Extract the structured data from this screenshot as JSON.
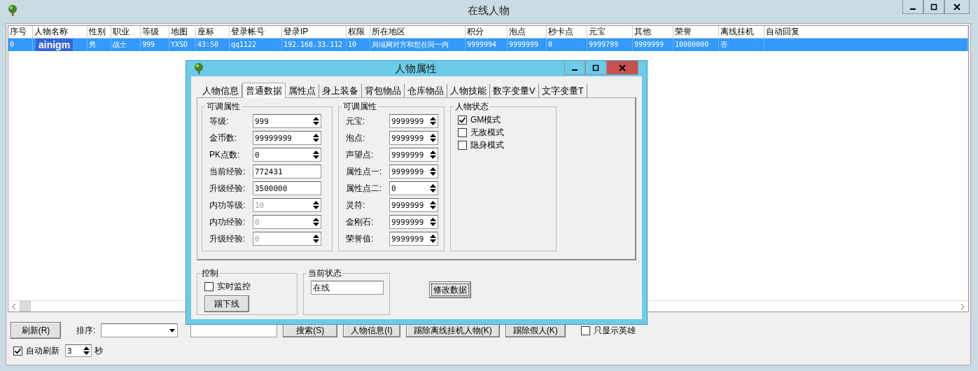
{
  "window": {
    "title": "在线人物"
  },
  "table": {
    "columns": [
      {
        "label": "序号",
        "kind": "plain"
      },
      {
        "label": "人物名称",
        "kind": "name"
      },
      {
        "label": "性别",
        "kind": "plain"
      },
      {
        "label": "职业",
        "kind": "plain"
      },
      {
        "label": "等级",
        "kind": "plain"
      },
      {
        "label": "地图",
        "kind": "plain"
      },
      {
        "label": "座标",
        "kind": "plain"
      },
      {
        "label": "登录帐号",
        "kind": "plain"
      },
      {
        "label": "登录IP",
        "kind": "plain"
      },
      {
        "label": "权限",
        "kind": "plain"
      },
      {
        "label": "所在地区",
        "kind": "plain"
      },
      {
        "label": "积分",
        "kind": "plain"
      },
      {
        "label": "泡点",
        "kind": "plain"
      },
      {
        "label": "秒卡点",
        "kind": "plain"
      },
      {
        "label": "元宝",
        "kind": "plain"
      },
      {
        "label": "其他",
        "kind": "plain"
      },
      {
        "label": "荣誉",
        "kind": "plain"
      },
      {
        "label": "离线挂机",
        "kind": "plain"
      },
      {
        "label": "自动回复",
        "kind": "plain"
      }
    ],
    "rows": [
      {
        "selected": true,
        "cells": [
          "0",
          "ainigm",
          "男",
          "战士",
          "999",
          "YXSD",
          "43:50",
          "qq1122",
          "192.168.33.112",
          "10",
          "局域网对方和您在同一内",
          "9999994",
          "9999999",
          "0",
          "9999799",
          "9999999",
          "10000000",
          "否",
          ""
        ]
      }
    ]
  },
  "bottom": {
    "refresh_button": "刷新(R)",
    "sort_label": "排序:",
    "buttons": [
      "搜索(S)",
      "人物信息(I)",
      "踢除离线挂机人物(K)",
      "踢除假人(K)"
    ],
    "heroes_only": {
      "label": "只显示英雄",
      "checked": false
    },
    "auto_refresh": {
      "label": "自动刷新",
      "checked": true
    },
    "interval": "3",
    "interval_unit": "秒"
  },
  "dialog": {
    "title": "人物属性",
    "tabs": [
      {
        "label": "人物信息",
        "selected": false
      },
      {
        "label": "普通数据",
        "selected": true
      },
      {
        "label": "属性点",
        "selected": false
      },
      {
        "label": "身上装备",
        "selected": false
      },
      {
        "label": "背包物品",
        "selected": false
      },
      {
        "label": "仓库物品",
        "selected": false
      },
      {
        "label": "人物技能",
        "selected": false
      },
      {
        "label": "数字变量V",
        "selected": false
      },
      {
        "label": "文字变量T",
        "selected": false
      }
    ],
    "groups": [
      {
        "title": "可调属性",
        "fields": [
          {
            "label": "等级:",
            "value": "999",
            "kind": "spin",
            "disabled": false
          },
          {
            "label": "金币数:",
            "value": "99999999",
            "kind": "spin",
            "disabled": false
          },
          {
            "label": "PK点数:",
            "value": "0",
            "kind": "spin",
            "disabled": false
          },
          {
            "label": "当前经验:",
            "value": "772431",
            "kind": "text",
            "disabled": false
          },
          {
            "label": "升级经验:",
            "value": "3500000",
            "kind": "text",
            "disabled": false
          },
          {
            "label": "内功等级:",
            "value": "10",
            "kind": "spin",
            "disabled": true
          },
          {
            "label": "内功经验:",
            "value": "0",
            "kind": "spin",
            "disabled": true
          },
          {
            "label": "升级经验:",
            "value": "0",
            "kind": "spin",
            "disabled": true
          }
        ]
      },
      {
        "title": "可调属性",
        "fields": [
          {
            "label": "元宝:",
            "value": "9999999",
            "kind": "spin",
            "disabled": false
          },
          {
            "label": "泡点:",
            "value": "9999999",
            "kind": "spin",
            "disabled": false
          },
          {
            "label": "声望点:",
            "value": "9999999",
            "kind": "spin",
            "disabled": false
          },
          {
            "label": "属性点一:",
            "value": "9999999",
            "kind": "spin",
            "disabled": false
          },
          {
            "label": "属性点二:",
            "value": "0",
            "kind": "spin",
            "disabled": false
          },
          {
            "label": "灵符:",
            "value": "9999999",
            "kind": "spin",
            "disabled": false
          },
          {
            "label": "金刚石:",
            "value": "9999999",
            "kind": "spin",
            "disabled": false
          },
          {
            "label": "荣誉值:",
            "value": "9999999",
            "kind": "spin",
            "disabled": false
          }
        ]
      }
    ],
    "status": {
      "title": "人物状态",
      "options": [
        {
          "label": "GM模式",
          "checked": true
        },
        {
          "label": "无敌模式",
          "checked": false
        },
        {
          "label": "隐身模式",
          "checked": false
        }
      ]
    },
    "control": {
      "title": "控制",
      "monitor": {
        "label": "实时监控",
        "checked": false
      },
      "kick_button": "踢下线"
    },
    "current_state": {
      "title": "当前状态",
      "value": "在线"
    },
    "save_button": "修改数据"
  }
}
